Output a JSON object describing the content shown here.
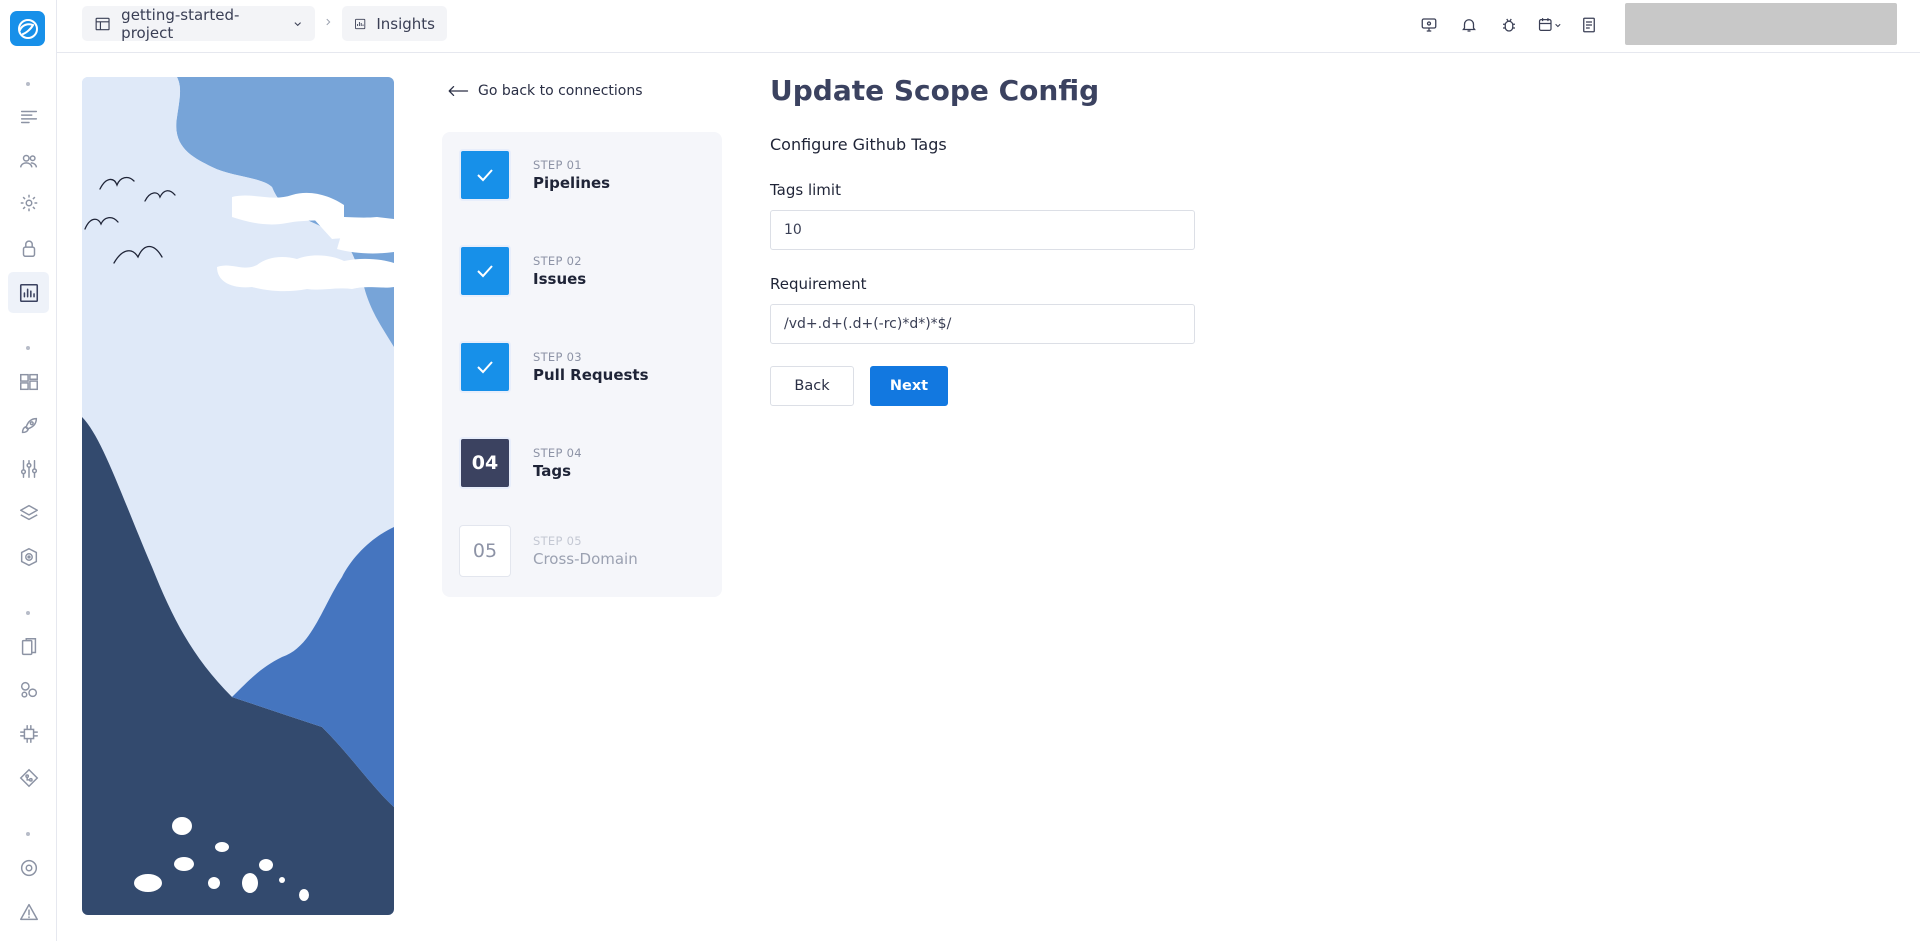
{
  "topbar": {
    "project_name": "getting-started-project",
    "section_name": "Insights"
  },
  "connections": {
    "back_label": "Go back to connections"
  },
  "steps": [
    {
      "number": "STEP 01",
      "name": "Pipelines",
      "badge": "",
      "state": "done"
    },
    {
      "number": "STEP 02",
      "name": "Issues",
      "badge": "",
      "state": "done"
    },
    {
      "number": "STEP 03",
      "name": "Pull Requests",
      "badge": "",
      "state": "done"
    },
    {
      "number": "STEP 04",
      "name": "Tags",
      "badge": "04",
      "state": "current"
    },
    {
      "number": "STEP 05",
      "name": "Cross-Domain",
      "badge": "05",
      "state": "todo"
    }
  ],
  "form": {
    "title": "Update Scope Config",
    "subtitle": "Configure Github Tags",
    "tags_limit_label": "Tags limit",
    "tags_limit_value": "10",
    "requirement_label": "Requirement",
    "requirement_value": "/vd+.d+(.d+(-rc)*d*)*$/",
    "back_label": "Back",
    "next_label": "Next"
  },
  "colors": {
    "accent": "#1790e9",
    "primary_button": "#1278e0",
    "title": "#3b4260",
    "current_step": "#3b4260"
  }
}
